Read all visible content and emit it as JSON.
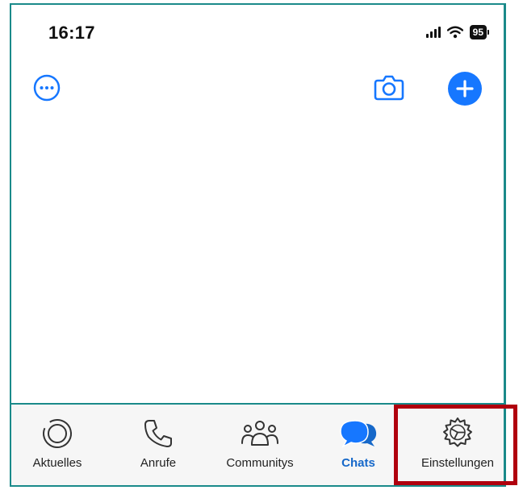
{
  "status_bar": {
    "time": "16:17",
    "battery": "95"
  },
  "top_bar": {
    "more_icon": "ellipsis-circle-icon",
    "camera_icon": "camera-icon",
    "new_chat_icon": "plus-icon"
  },
  "tab_bar": {
    "tabs": [
      {
        "label": "Aktuelles",
        "icon": "status-icon"
      },
      {
        "label": "Anrufe",
        "icon": "phone-icon"
      },
      {
        "label": "Communitys",
        "icon": "community-icon"
      },
      {
        "label": "Chats",
        "icon": "chat-bubbles-icon",
        "active": true
      },
      {
        "label": "Einstellungen",
        "icon": "gear-icon"
      }
    ]
  },
  "colors": {
    "accent": "#1677ff",
    "active_tab": "#1668c9",
    "frame": "#1a8a8a",
    "highlight": "#b0000e"
  }
}
